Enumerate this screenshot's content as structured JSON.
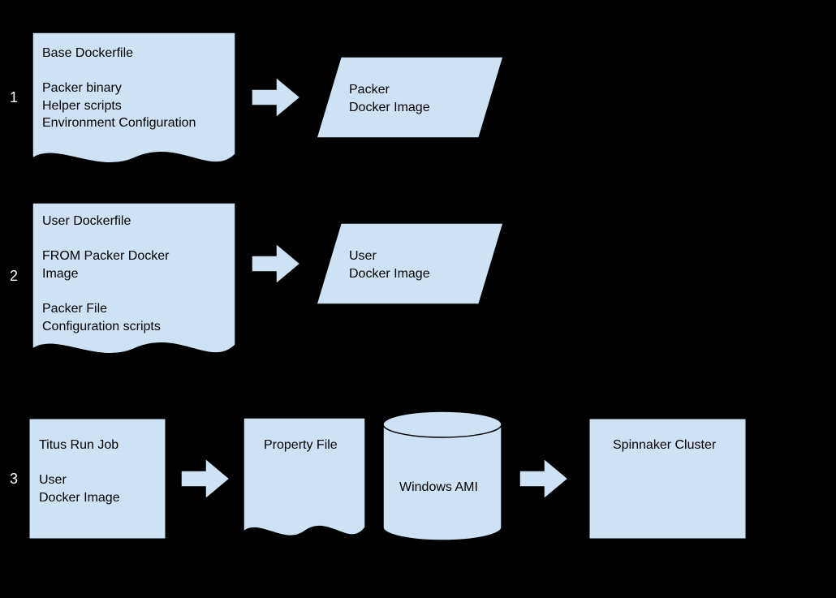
{
  "rows": {
    "r1": {
      "label": "1",
      "doc": {
        "title": "Base Dockerfile",
        "lines": [
          "Packer binary",
          "Helper scripts",
          "Environment Configuration"
        ]
      },
      "para": {
        "line1": "Packer",
        "line2": "Docker Image"
      }
    },
    "r2": {
      "label": "2",
      "doc": {
        "title": "User Dockerfile",
        "subtitle": "FROM Packer Docker Image",
        "lines": [
          "Packer File",
          "Configuration scripts"
        ]
      },
      "para": {
        "line1": "User",
        "line2": "Docker Image"
      }
    },
    "r3": {
      "label": "3",
      "box": {
        "title": "Titus Run Job",
        "line1": "User",
        "line2": "Docker Image"
      },
      "file": {
        "label": "Property File"
      },
      "cyl": {
        "label": "Windows AMI"
      },
      "cluster": {
        "label": "Spinnaker Cluster"
      }
    }
  },
  "colors": {
    "fill": "#cfe2f3",
    "stroke": "#000000"
  }
}
